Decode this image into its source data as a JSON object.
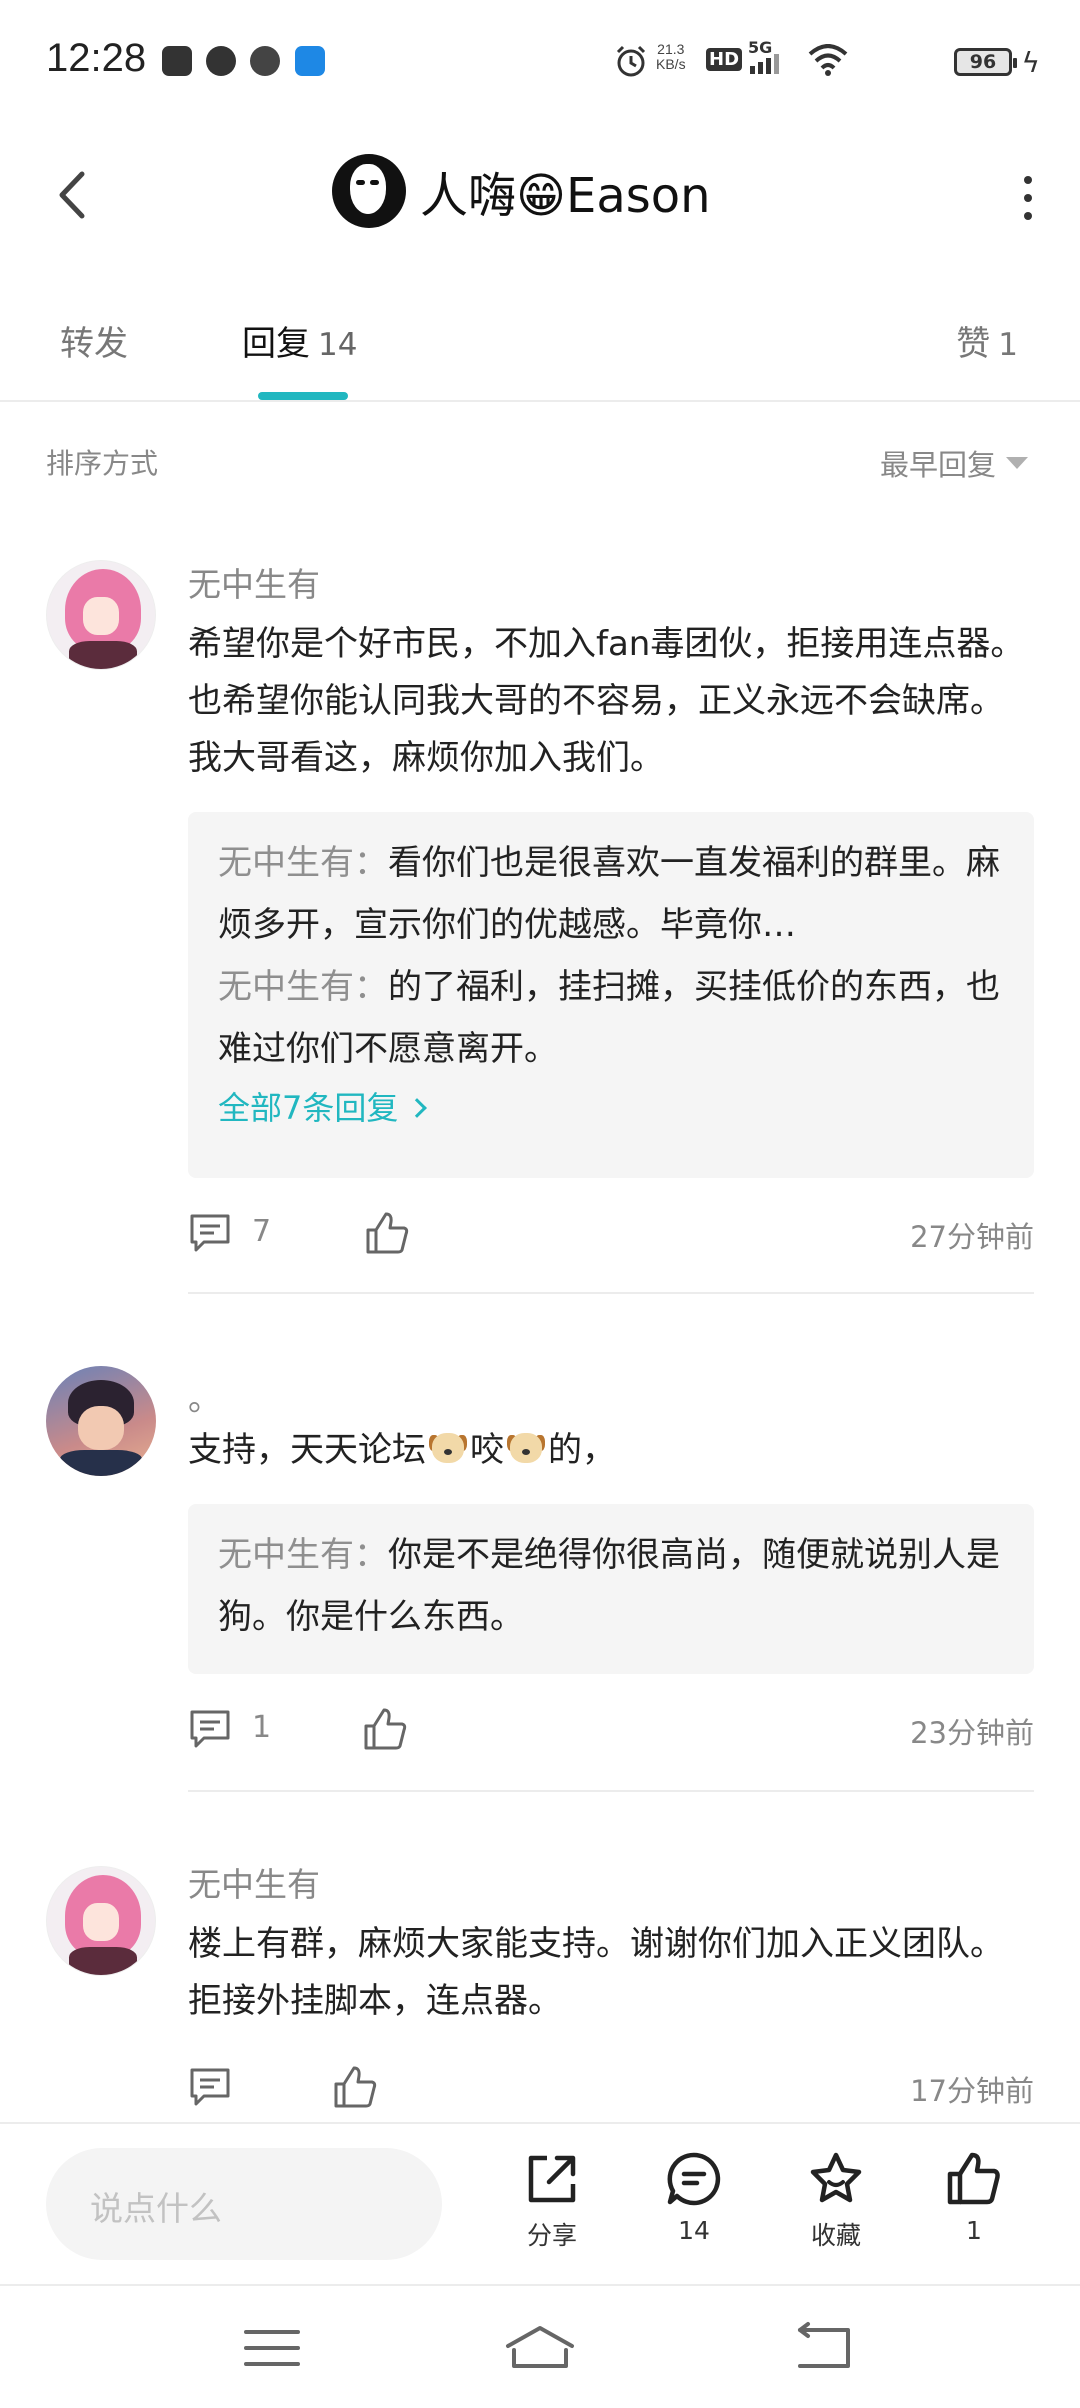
{
  "status_bar": {
    "time": "12:28",
    "net_speed_value": "21.3",
    "net_speed_unit": "KB/s",
    "hd_label": "HD",
    "network_label": "5G",
    "battery": "96",
    "app_icons": [
      "youku-icon",
      "browser-icon",
      "weibo-icon",
      "tool-icon"
    ]
  },
  "header": {
    "title": "人嗨😁Eason"
  },
  "tabs": {
    "forward": "转发",
    "reply": "回复",
    "reply_count": "14",
    "like": "赞",
    "like_count": "1",
    "accent": "#21b7c0"
  },
  "sort": {
    "label": "排序方式",
    "value": "最早回复"
  },
  "comments": [
    {
      "user": "无中生有",
      "text": "希望你是个好市民，不加入fan毒团伙，拒接用连点器。也希望你能认同我大哥的不容易，正义永远不会缺席。我大哥看这，麻烦你加入我们。",
      "replies": [
        {
          "user": "无中生有",
          "text": "看你们也是很喜欢一直发福利的群里。麻烦多开，宣示你们的优越感。毕竟你…"
        },
        {
          "user": "无中生有",
          "text": "的了福利，挂扫摊，买挂低价的东西，也难过你们不愿意离开。"
        }
      ],
      "all_replies": "全部7条回复",
      "reply_count": "7",
      "time": "27分钟前"
    },
    {
      "user": "。",
      "text_before": "支持，天天论坛",
      "text_mid": "咬",
      "text_after": "的，",
      "replies": [
        {
          "user": "无中生有",
          "text": "你是不是绝得你很高尚，随便就说别人是狗。你是什么东西。"
        }
      ],
      "reply_count": "1",
      "time": "23分钟前"
    },
    {
      "user": "无中生有",
      "text": "楼上有群，麻烦大家能支持。谢谢你们加入正义团队。拒接外挂脚本，连点器。",
      "time": "17分钟前"
    }
  ],
  "bottom_bar": {
    "input_placeholder": "说点什么",
    "share": "分享",
    "comments": "14",
    "favorite": "收藏",
    "likes": "1"
  }
}
